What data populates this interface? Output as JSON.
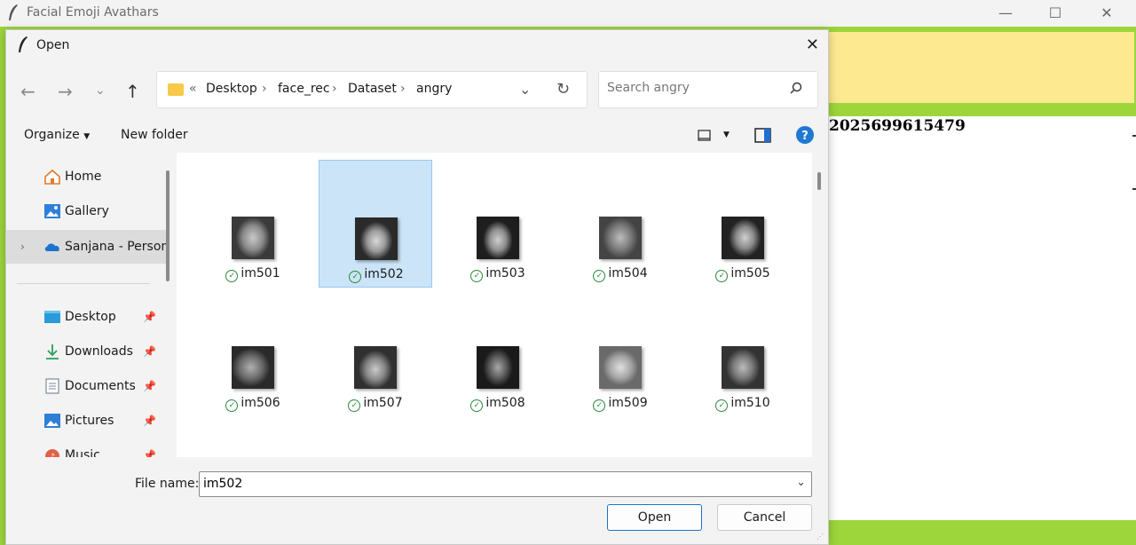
{
  "app": {
    "title": "Facial Emoji Avathars",
    "output_text": "2025699615479",
    "controls": {
      "minimize": "—",
      "maximize": "☐",
      "close": "✕"
    }
  },
  "dialog": {
    "title": "Open",
    "close": "✕",
    "address": {
      "overflow": "«",
      "segments": [
        "Desktop",
        "face_rec",
        "Dataset",
        "angry"
      ]
    },
    "search": {
      "placeholder": "Search angry"
    },
    "toolbar": {
      "organize": "Organize",
      "new_folder": "New folder"
    },
    "sidebar": {
      "items": [
        {
          "label": "Home",
          "icon": "home-icon"
        },
        {
          "label": "Gallery",
          "icon": "gallery-icon"
        },
        {
          "label": "Sanjana - Person",
          "icon": "onedrive-icon",
          "selected": true
        },
        {
          "label": "Desktop",
          "icon": "desktop-icon",
          "pinned": true
        },
        {
          "label": "Downloads",
          "icon": "download-icon",
          "pinned": true
        },
        {
          "label": "Documents",
          "icon": "documents-icon",
          "pinned": true
        },
        {
          "label": "Pictures",
          "icon": "pictures-icon",
          "pinned": true
        },
        {
          "label": "Music",
          "icon": "music-icon",
          "pinned": true
        }
      ]
    },
    "files": [
      {
        "name": "im501",
        "selected": false
      },
      {
        "name": "im502",
        "selected": true
      },
      {
        "name": "im503",
        "selected": false
      },
      {
        "name": "im504",
        "selected": false
      },
      {
        "name": "im505",
        "selected": false
      },
      {
        "name": "im506",
        "selected": false
      },
      {
        "name": "im507",
        "selected": false
      },
      {
        "name": "im508",
        "selected": false
      },
      {
        "name": "im509",
        "selected": false
      },
      {
        "name": "im510",
        "selected": false
      }
    ],
    "file_name_label": "File name:",
    "file_name_value": "im502",
    "open_button": "Open",
    "cancel_button": "Cancel"
  }
}
